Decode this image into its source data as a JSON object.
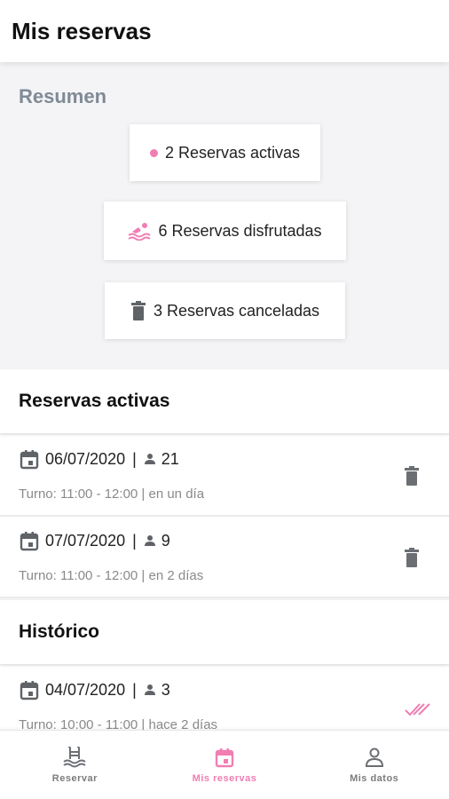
{
  "app_bar": {
    "title": "Mis reservas"
  },
  "summary": {
    "title": "Resumen",
    "active_label": "2 Reservas activas",
    "enjoyed_label": "6 Reservas disfrutadas",
    "cancelled_label": "3 Reservas canceladas"
  },
  "active_section": {
    "title": "Reservas activas",
    "bookings": [
      {
        "date": "06/07/2020",
        "people": "21",
        "turn": "Turno: 11:00 - 12:00 | en un día"
      },
      {
        "date": "07/07/2020",
        "people": "9",
        "turn": "Turno: 11:00 - 12:00 | en 2 días"
      }
    ]
  },
  "history_section": {
    "title": "Histórico",
    "bookings": [
      {
        "date": "04/07/2020",
        "people": "3",
        "turn": "Turno: 10:00 - 11:00 | hace 2 días"
      }
    ]
  },
  "bottom_nav": {
    "items": [
      {
        "label": "Reservar",
        "icon": "pool-icon"
      },
      {
        "label": "Mis reservas",
        "icon": "calendar-icon"
      },
      {
        "label": "Mis datos",
        "icon": "person-icon"
      }
    ],
    "active_index": 1
  },
  "colors": {
    "accent": "#f07eb3",
    "summary_title": "#7f8a96",
    "icon_gray": "#5f6368",
    "muted_text": "#8a8a8a",
    "background": "#f4f4f6"
  }
}
